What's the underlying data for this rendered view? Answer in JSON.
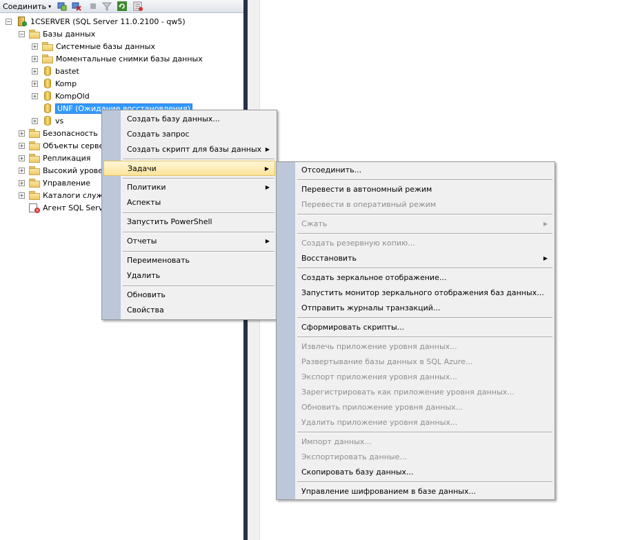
{
  "toolbar": {
    "connect_label": "Соединить",
    "connect_arrow": "▾",
    "icons": [
      "connect-object-explorer-icon",
      "disconnect-icon",
      "stop-icon",
      "filter-icon",
      "refresh-icon",
      "properties-icon"
    ]
  },
  "tree": {
    "server": "1CSERVER (SQL Server 11.0.2100 - qw5)",
    "databases": "Базы данных",
    "system_databases": "Системные базы данных",
    "snapshots": "Моментальные снимки базы данных",
    "db_bastet": "bastet",
    "db_komp": "Komp",
    "db_kompold": "KompOld",
    "db_unf": "UNF (Ожидание восстановления)",
    "db_vs": "vs",
    "security": "Безопасность",
    "server_objects": "Объекты серве",
    "replication": "Репликация",
    "high_availability": "Высокий урове",
    "management": "Управление",
    "catalogs": "Каталоги служ",
    "agent": "Агент SQL Serve"
  },
  "context_menu": {
    "create_db": "Создать базу данных...",
    "new_query": "Создать запрос",
    "script_db": "Создать скрипт для базы данных",
    "tasks": "Задачи",
    "policies": "Политики",
    "facets": "Аспекты",
    "powershell": "Запустить PowerShell",
    "reports": "Отчеты",
    "rename": "Переименовать",
    "delete": "Удалить",
    "refresh": "Обновить",
    "properties": "Свойства",
    "submenu_arrow": "▶"
  },
  "tasks_menu": {
    "detach": "Отсоединить...",
    "take_offline": "Перевести в автономный режим",
    "bring_online": "Перевести в оперативный режим",
    "shrink": "Сжать",
    "backup": "Создать резервную копию...",
    "restore": "Восстановить",
    "mirror": "Создать зеркальное отображение...",
    "mirror_monitor": "Запустить монитор зеркального отображения баз данных...",
    "ship_logs": "Отправить журналы транзакций...",
    "generate_scripts": "Сформировать скрипты...",
    "extract_dac": "Извлечь приложение уровня данных...",
    "deploy_azure": "Развертывание базы данных в SQL Azure...",
    "export_dac": "Экспорт приложения уровня данных...",
    "register_dac": "Зарегистрировать как приложение уровня данных...",
    "upgrade_dac": "Обновить приложение уровня данных...",
    "delete_dac": "Удалить приложение уровня данных...",
    "import_data": "Импорт данных...",
    "export_data": "Экспортировать данные...",
    "copy_db": "Скопировать базу данных...",
    "encryption": "Управление шифрованием в базе данных...",
    "submenu_arrow": "▶"
  }
}
